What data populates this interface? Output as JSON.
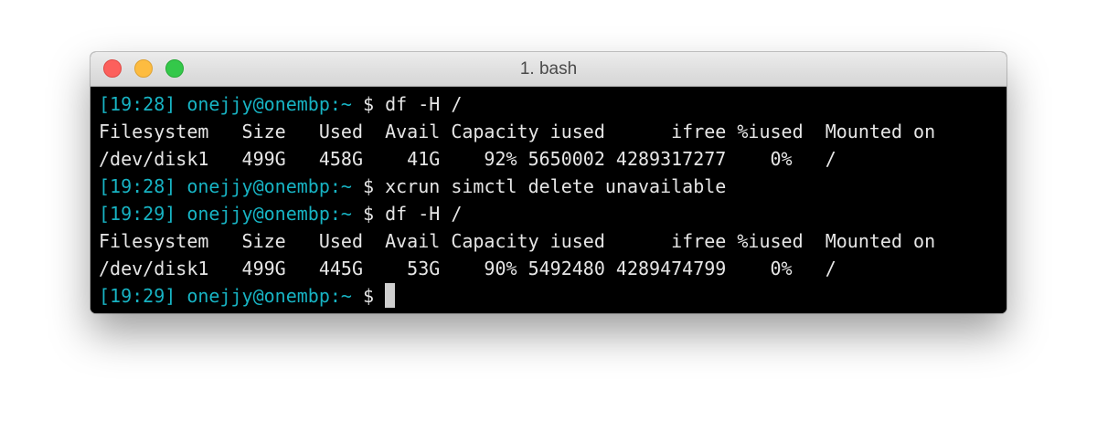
{
  "window": {
    "title": "1. bash"
  },
  "terminal": {
    "lines": [
      {
        "prompt": "[19:28] onejjy@onembp:~",
        "command": " $ df -H /"
      },
      {
        "text": "Filesystem   Size   Used  Avail Capacity iused      ifree %iused  Mounted on"
      },
      {
        "text": "/dev/disk1   499G   458G    41G    92% 5650002 4289317277    0%   /"
      },
      {
        "prompt": "[19:28] onejjy@onembp:~",
        "command": " $ xcrun simctl delete unavailable"
      },
      {
        "prompt": "[19:29] onejjy@onembp:~",
        "command": " $ df -H /"
      },
      {
        "text": "Filesystem   Size   Used  Avail Capacity iused      ifree %iused  Mounted on"
      },
      {
        "text": "/dev/disk1   499G   445G    53G    90% 5492480 4289474799    0%   /"
      },
      {
        "prompt": "[19:29] onejjy@onembp:~",
        "command": " $ "
      }
    ]
  },
  "colors": {
    "prompt": "#17b3c3",
    "text": "#e6e6e6",
    "background": "#000000"
  }
}
